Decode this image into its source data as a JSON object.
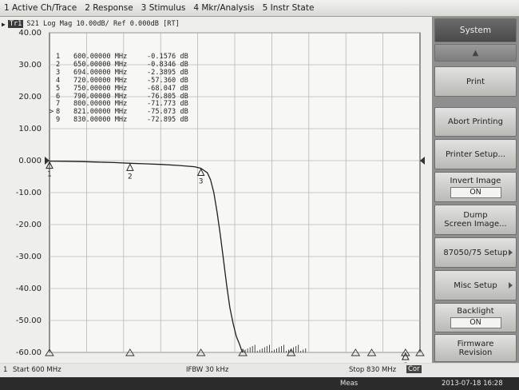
{
  "menubar": {
    "items": [
      "1 Active Ch/Trace",
      "2 Response",
      "3 Stimulus",
      "4 Mkr/Analysis",
      "5 Instr State"
    ]
  },
  "trace": {
    "badge": "Tr1",
    "header": "S21 Log Mag 10.00dB/ Ref 0.000dB [RT]"
  },
  "markers": [
    {
      "id": "1",
      "active": false,
      "freq": "600.00000 MHz",
      "value": "-0.1576 dB"
    },
    {
      "id": "2",
      "active": false,
      "freq": "650.00000 MHz",
      "value": "-0.8346 dB"
    },
    {
      "id": "3",
      "active": false,
      "freq": "694.00000 MHz",
      "value": "-2.3895 dB"
    },
    {
      "id": "4",
      "active": false,
      "freq": "720.00000 MHz",
      "value": "-57.360 dB"
    },
    {
      "id": "5",
      "active": false,
      "freq": "750.00000 MHz",
      "value": "-68.047 dB"
    },
    {
      "id": "6",
      "active": false,
      "freq": "790.00000 MHz",
      "value": "-76.805 dB"
    },
    {
      "id": "7",
      "active": false,
      "freq": "800.00000 MHz",
      "value": "-71.773 dB"
    },
    {
      "id": "8",
      "active": true,
      "freq": "821.00000 MHz",
      "value": "-75.073 dB"
    },
    {
      "id": "9",
      "active": false,
      "freq": "830.00000 MHz",
      "value": "-72.895 dB"
    }
  ],
  "chart_data": {
    "type": "line",
    "xlabel": "",
    "ylabel": "",
    "xlim": [
      600,
      830
    ],
    "ylim": [
      -60,
      40
    ],
    "yticks": [
      40,
      30,
      20,
      10,
      0,
      -10,
      -20,
      -30,
      -40,
      -50,
      -60
    ],
    "ytick_labels": [
      "40.00",
      "30.00",
      "20.00",
      "10.00",
      "0.000",
      "-10.00",
      "-20.00",
      "-30.00",
      "-40.00",
      "-50.00",
      "-60.00"
    ],
    "grid": true,
    "trace_color": "#1f1f1f",
    "series": [
      {
        "x": [
          600,
          610,
          620,
          630,
          640,
          650,
          660,
          670,
          680,
          690,
          694,
          698,
          700,
          702,
          704,
          706,
          708,
          710,
          712,
          714,
          716,
          718,
          719,
          720
        ],
        "y": [
          -0.16,
          -0.2,
          -0.3,
          -0.45,
          -0.6,
          -0.83,
          -1.0,
          -1.2,
          -1.5,
          -1.9,
          -2.39,
          -3.8,
          -6.0,
          -10.0,
          -16.0,
          -23.0,
          -31.0,
          -39.0,
          -46.0,
          -51.0,
          -55.0,
          -57.5,
          -59.0,
          -60
        ]
      }
    ],
    "noise_region": [
      720,
      760
    ],
    "marker_positions_mhz": [
      600,
      650,
      694,
      720,
      750,
      790,
      800,
      821,
      830
    ],
    "marker_labels_shown": [
      "1",
      "2",
      "3",
      "8"
    ]
  },
  "softkeys": {
    "header": "System",
    "items": [
      {
        "label": "Print",
        "state": null,
        "submenu": false
      },
      {
        "label": "Abort Printing",
        "state": null,
        "submenu": false
      },
      {
        "label": "Printer Setup...",
        "state": null,
        "submenu": false
      },
      {
        "label": "Invert Image",
        "state": "ON",
        "submenu": false
      },
      {
        "label": "Dump\nScreen Image...",
        "state": null,
        "submenu": false
      },
      {
        "label": "87050/75 Setup",
        "state": null,
        "submenu": true
      },
      {
        "label": "Misc Setup",
        "state": null,
        "submenu": true
      },
      {
        "label": "Backlight",
        "state": "ON",
        "submenu": false
      },
      {
        "label": "Firmware\nRevision",
        "state": null,
        "submenu": false
      }
    ]
  },
  "statusbar": {
    "channel": "1",
    "start": "Start 600 MHz",
    "ifbw": "IFBW 30 kHz",
    "stop": "Stop 830 MHz",
    "cor": "Cor",
    "meas": "Meas",
    "datetime": "2013-07-18 16:28"
  }
}
